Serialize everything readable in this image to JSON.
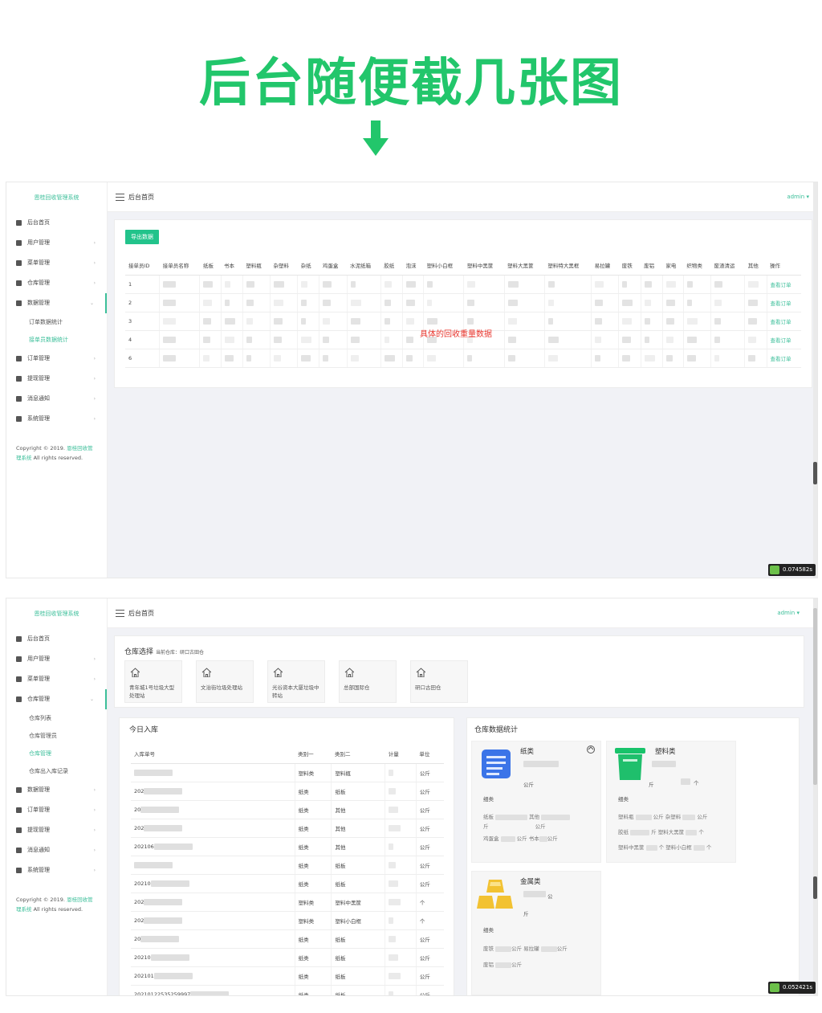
{
  "hero": {
    "title": "后台随便截几张图"
  },
  "app": {
    "brand": "恩桂回收管理系统",
    "page_title": "后台首页",
    "admin": "admin",
    "copyright_prefix": "Copyright © 2019.",
    "copyright_link": "恩桂回收管理系统",
    "copyright_suffix": "All rights reserved."
  },
  "shot1": {
    "menu": [
      {
        "label": "后台首页",
        "chev": ""
      },
      {
        "label": "用户管理",
        "chev": "›"
      },
      {
        "label": "菜单管理",
        "chev": "›"
      },
      {
        "label": "仓库管理",
        "chev": "›"
      },
      {
        "label": "数据管理",
        "chev": "⌄"
      }
    ],
    "submenu": [
      "订单数据统计",
      "接单员数据统计"
    ],
    "menu_after": [
      {
        "label": "订单管理",
        "chev": "›"
      },
      {
        "label": "提现管理",
        "chev": "›"
      },
      {
        "label": "消息通知",
        "chev": "›"
      },
      {
        "label": "系统管理",
        "chev": "›"
      }
    ],
    "export_button": "导出数据",
    "columns": [
      "接单员ID",
      "接单员名称",
      "纸板",
      "书本",
      "塑料瓶",
      "杂塑料",
      "杂纸",
      "鸡蛋盒",
      "水泥纸箱",
      "胶纸",
      "泡沫",
      "塑料小白框",
      "塑料中黑筐",
      "塑料大黑筐",
      "塑料特大黑框",
      "易拉罐",
      "废铁",
      "废铝",
      "家电",
      "织物类",
      "废渣清运",
      "其他",
      "操作"
    ],
    "rows": [
      {
        "id": "1",
        "action": "查看订单"
      },
      {
        "id": "2",
        "action": "查看订单"
      },
      {
        "id": "3",
        "action": "查看订单"
      },
      {
        "id": "4",
        "action": "查看订单"
      },
      {
        "id": "6",
        "action": "查看订单"
      }
    ],
    "annotation": "具体的回收重量数据",
    "timer": "0.074582s"
  },
  "shot2": {
    "menu": [
      {
        "label": "后台首页",
        "chev": ""
      },
      {
        "label": "用户管理",
        "chev": "›"
      },
      {
        "label": "菜单管理",
        "chev": "›"
      },
      {
        "label": "仓库管理",
        "chev": "⌄"
      }
    ],
    "submenu": [
      "仓库列表",
      "仓库管理员",
      "仓库管理",
      "仓库出入库记录"
    ],
    "menu_after": [
      {
        "label": "数据管理",
        "chev": "›"
      },
      {
        "label": "订单管理",
        "chev": "›"
      },
      {
        "label": "提现管理",
        "chev": "›"
      },
      {
        "label": "消息通知",
        "chev": "›"
      },
      {
        "label": "系统管理",
        "chev": "›"
      }
    ],
    "warehouse_select": {
      "title": "仓库选择",
      "current": "当前仓库：研口古田仓",
      "warehouses": [
        "青年城1号垃圾大型处理站",
        "文治街垃圾处理站",
        "光谷资本大厦垃圾中转站",
        "总部国际仓",
        "研口古田仓"
      ]
    },
    "today_in": {
      "title": "今日入库",
      "columns": [
        "入库单号",
        "类别一",
        "类别二",
        "计量",
        "单位"
      ],
      "rows": [
        {
          "no": "",
          "c1": "塑料类",
          "c2": "塑料瓶",
          "unit": "公斤"
        },
        {
          "no": "202",
          "c1": "纸类",
          "c2": "纸板",
          "unit": "公斤"
        },
        {
          "no": "20",
          "c1": "纸类",
          "c2": "其他",
          "unit": "公斤"
        },
        {
          "no": "202",
          "c1": "纸类",
          "c2": "其他",
          "unit": "公斤"
        },
        {
          "no": "202106",
          "c1": "纸类",
          "c2": "其他",
          "unit": "公斤"
        },
        {
          "no": "",
          "c1": "纸类",
          "c2": "纸板",
          "unit": "公斤"
        },
        {
          "no": "20210",
          "c1": "纸类",
          "c2": "纸板",
          "unit": "公斤"
        },
        {
          "no": "202",
          "c1": "塑料类",
          "c2": "塑料中黑筐",
          "unit": "个"
        },
        {
          "no": "202",
          "c1": "塑料类",
          "c2": "塑料小白框",
          "unit": "个"
        },
        {
          "no": "20",
          "c1": "纸类",
          "c2": "纸板",
          "unit": "公斤"
        },
        {
          "no": "20210",
          "c1": "纸类",
          "c2": "纸板",
          "unit": "公斤"
        },
        {
          "no": "202101",
          "c1": "纸类",
          "c2": "纸板",
          "unit": "公斤"
        },
        {
          "no": "20210122535259997",
          "c1": "纸类",
          "c2": "纸板",
          "unit": "公斤"
        }
      ]
    },
    "stats": {
      "title": "仓库数据统计",
      "paper": {
        "name": "纸类",
        "unit": "公斤",
        "detail": "细类",
        "items": [
          "纸板",
          "其他",
          "斤",
          "公斤",
          "鸡蛋盒",
          "公斤",
          "书本",
          "公斤"
        ]
      },
      "plastic": {
        "name": "塑料类",
        "unit": "斤",
        "unit2": "个",
        "detail": "细类",
        "items": [
          "塑料瓶",
          "公斤",
          "杂塑料",
          "公斤",
          "胶纸",
          "斤",
          "塑料大黑筐",
          "个",
          "塑料中黑筐",
          "个",
          "塑料小白框",
          "个"
        ]
      },
      "metal": {
        "name": "金属类",
        "unit": "斤",
        "unit_small": "公",
        "detail": "细类",
        "items": [
          "废铁",
          "公斤",
          "易拉罐",
          "公斤",
          "废铝",
          "公斤"
        ]
      }
    },
    "timer": "0.052421s"
  },
  "colors": {
    "accent": "#3cbf9a",
    "hero_green": "#22c66b",
    "export_button": "#22c38b",
    "annotation_red": "#e8352d"
  }
}
